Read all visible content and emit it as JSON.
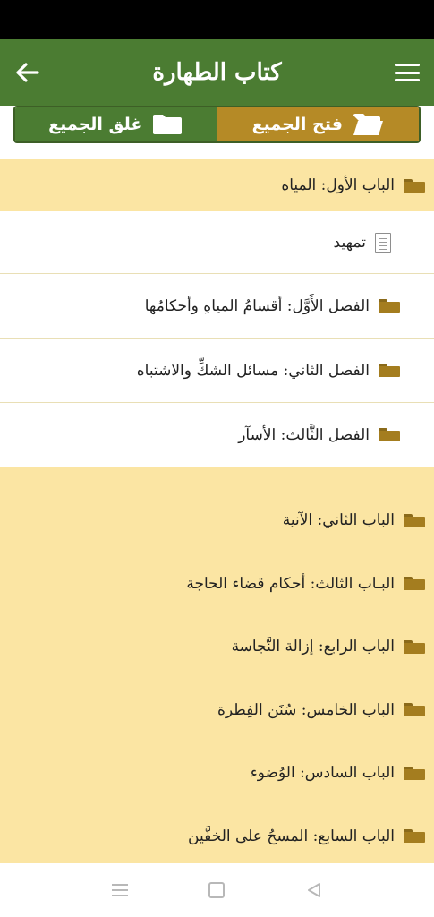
{
  "header": {
    "title": "كتاب الطهارة",
    "back_icon": "arrow-left-icon",
    "menu_icon": "hamburger-menu-icon",
    "bar_color": "#4b7c32"
  },
  "toggle": {
    "open_all": "فتح الجميع",
    "close_all": "غلق الجميع",
    "open_color": "#b58a26",
    "close_color": "#4b7c32"
  },
  "chapters": [
    {
      "label": "الباب الأول: المياه",
      "intro": "تمهيد",
      "sections": [
        "الفصل الأَوَّل: أقسامُ المياهِ وأحكامُها",
        "الفصل الثاني: مسائل الشكِّ والاشتباه",
        "الفصل الثَّالث: الأسآر"
      ]
    },
    {
      "label": "الباب الثاني: الآنية"
    },
    {
      "label": "البـاب الثالث: أحكام قضاء الحاجة"
    },
    {
      "label": "الباب الرابع: إزالة النَّجاسة"
    },
    {
      "label": "الباب الخامس: سُنَن الفِطرة"
    },
    {
      "label": "الباب السادس: الوُضوء"
    },
    {
      "label": "الباب السابع: المسحُ على الخفَّين"
    }
  ],
  "colors": {
    "chapter_bg": "#fbe5a3",
    "folder": "#a47d1f"
  }
}
